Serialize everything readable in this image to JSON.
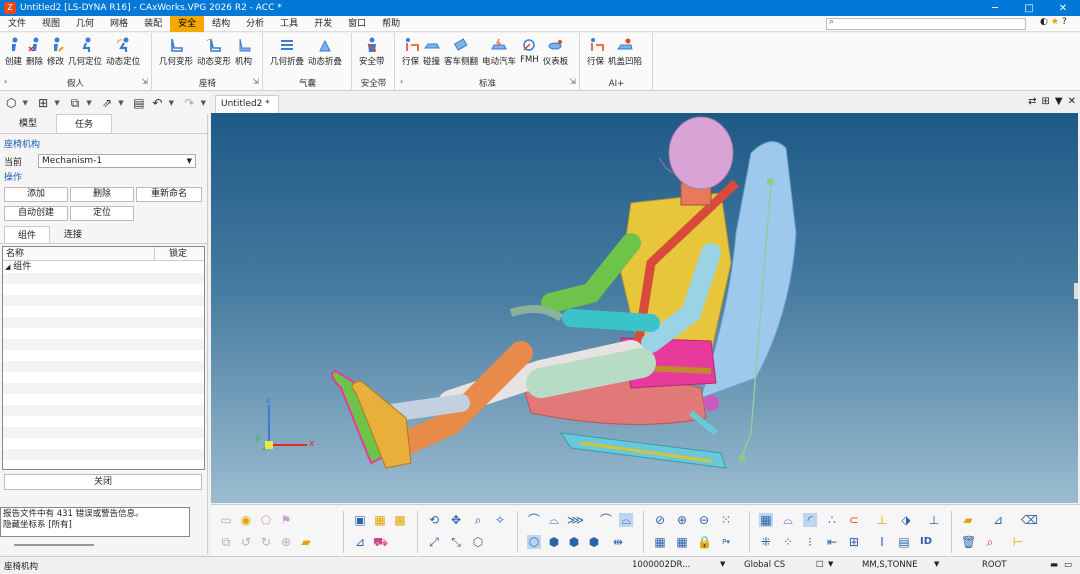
{
  "window": {
    "title": "Untitled2 [LS-DYNA R16] - CAxWorks.VPG 2026 R2 - ACC *",
    "logo": "Z",
    "controls": [
      "─",
      "□",
      "✕"
    ]
  },
  "menu": {
    "items": [
      "文件",
      "视图",
      "几何",
      "网格",
      "装配",
      "安全",
      "结构",
      "分析",
      "工具",
      "开发",
      "窗口",
      "帮助"
    ],
    "active": "安全",
    "right_icons": [
      "◐",
      "★",
      "?"
    ]
  },
  "ribbon": {
    "groups": [
      {
        "name": "假人",
        "buttons": [
          "创建",
          "删除",
          "修改",
          "几何定位",
          "动态定位"
        ]
      },
      {
        "name": "座椅",
        "buttons": [
          "几何变形",
          "动态变形",
          "机构"
        ]
      },
      {
        "name": "气囊",
        "buttons": [
          "几何折叠",
          "动态折叠"
        ]
      },
      {
        "name": "安全带",
        "buttons": [
          "安全带"
        ]
      },
      {
        "name": "标准",
        "buttons": [
          "行保",
          "碰撞",
          "客车侧翻",
          "电动汽车",
          "FMH",
          "仪表板"
        ]
      },
      {
        "name": "AI+",
        "buttons": [
          "行保",
          "机盖凹陷"
        ]
      }
    ]
  },
  "left_panel": {
    "tabs": [
      "模型",
      "任务"
    ],
    "active_tab": "任务",
    "section_title": "座椅机构",
    "current_label": "当前",
    "current_value": "Mechanism-1",
    "ops_title": "操作",
    "buttons_row1": [
      "添加",
      "删除",
      "重新命名"
    ],
    "buttons_row2": [
      "自动创建",
      "定位"
    ],
    "sub_tabs": [
      "组件",
      "连接"
    ],
    "columns": [
      "名称",
      "锁定"
    ],
    "tree_root": "组件",
    "close_label": "关闭"
  },
  "messages": [
    "报告文件中有 431 错误或警告信息。",
    "隐藏坐标系 [所有]"
  ],
  "viewport": {
    "tab": "Untitled2 *",
    "axes": {
      "x": "x",
      "y": "y",
      "z": "z"
    },
    "tab_icons": [
      "⇄",
      "⊞",
      "▼",
      "✕"
    ]
  },
  "status": {
    "left": "座椅机构",
    "count": "1000002",
    "dr": "DR...",
    "cs": "Global CS",
    "units": "MM,S,TONNE",
    "root": "ROOT"
  },
  "colors": {
    "accent": "#f5a800",
    "title": "#0078d7"
  }
}
